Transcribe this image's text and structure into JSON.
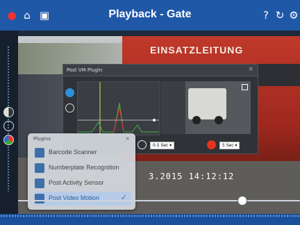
{
  "header": {
    "title": "Playback - Gate",
    "help_glyph": "?",
    "reload_glyph": "↻",
    "settings_glyph": "⚙"
  },
  "camera_image": {
    "truck_text": "EINSATZLEITUNG",
    "timestamp": "3.2015   14:12:12"
  },
  "post_vm_panel": {
    "title": "Post VM Plugin",
    "close_glyph": "×",
    "duration1": "0.5 Sec ▾",
    "duration2": "5 Sec ▾",
    "record_color": "#e5331e",
    "blue_dot_color": "#2f8fd8"
  },
  "plugins_panel": {
    "title": "Plugins",
    "close_glyph": "×",
    "items": [
      {
        "label": "Barcode Scanner"
      },
      {
        "label": "Numberplate Recognition"
      },
      {
        "label": "Post Activity Sensor"
      },
      {
        "label": "Post Video Motion",
        "checkmark": "✓"
      }
    ]
  },
  "colors": {
    "accent": "#2058a8",
    "selected_bg": "#b7cbe6"
  }
}
